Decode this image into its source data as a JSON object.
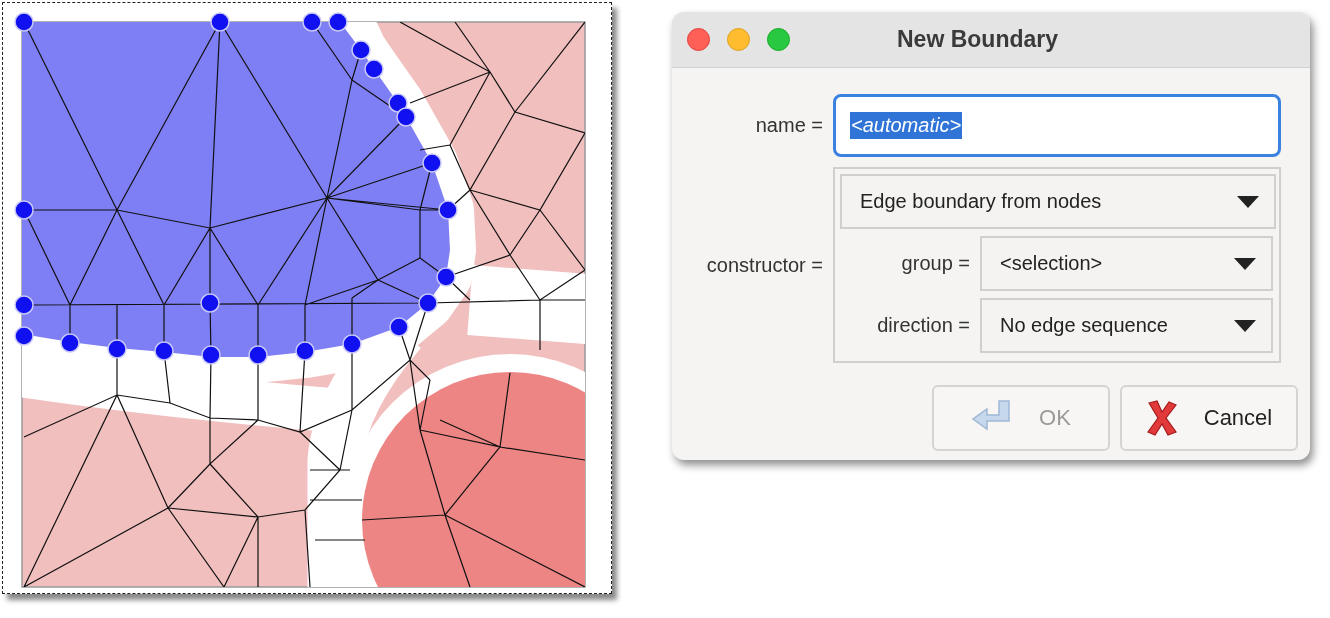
{
  "window": {
    "title": "New Boundary"
  },
  "form": {
    "name": {
      "label": "name =",
      "value": "<automatic>",
      "text_selected": true,
      "focused": true
    },
    "constructor": {
      "label": "constructor =",
      "value": "Edge boundary from nodes",
      "fields": [
        {
          "label": "group =",
          "value": "<selection>"
        },
        {
          "label": "direction =",
          "value": "No edge sequence"
        }
      ]
    }
  },
  "buttons": [
    {
      "kind": "ok",
      "label": "OK",
      "disabled": true
    },
    {
      "kind": "cancel",
      "label": "Cancel",
      "disabled": false
    }
  ]
}
